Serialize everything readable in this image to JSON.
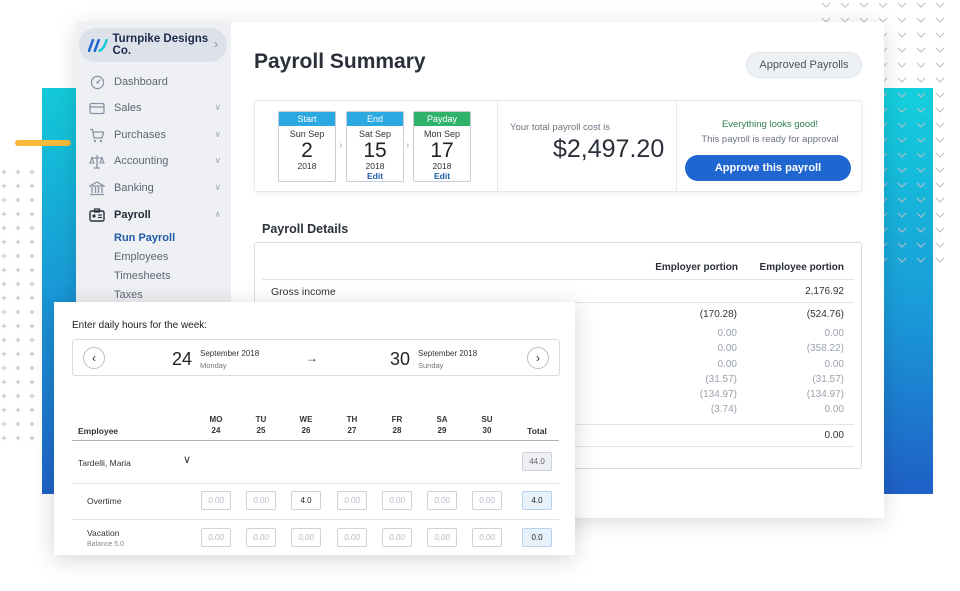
{
  "company": {
    "name": "Turnpike Designs Co."
  },
  "sidebar": {
    "items": [
      {
        "label": "Dashboard",
        "icon": "dashboard-icon",
        "expandable": false
      },
      {
        "label": "Sales",
        "icon": "sales-icon",
        "expandable": true
      },
      {
        "label": "Purchases",
        "icon": "cart-icon",
        "expandable": true
      },
      {
        "label": "Accounting",
        "icon": "scales-icon",
        "expandable": true
      },
      {
        "label": "Banking",
        "icon": "bank-icon",
        "expandable": true
      },
      {
        "label": "Payroll",
        "icon": "payroll-icon",
        "expandable": true,
        "active": true
      }
    ],
    "payroll_sub": [
      "Run Payroll",
      "Employees",
      "Timesheets",
      "Taxes"
    ]
  },
  "page": {
    "title": "Payroll Summary",
    "approved_payrolls_label": "Approved Payrolls"
  },
  "summary": {
    "dates": [
      {
        "head": "Start",
        "dow": "Sun Sep",
        "day": "2",
        "year": "2018",
        "edit": "",
        "color": "#2aa9e0"
      },
      {
        "head": "End",
        "dow": "Sat Sep",
        "day": "15",
        "year": "2018",
        "edit": "Edit",
        "color": "#2aa9e0"
      },
      {
        "head": "Payday",
        "dow": "Mon Sep",
        "day": "17",
        "year": "2018",
        "edit": "Edit",
        "color": "#2fb36b"
      }
    ],
    "total_label": "Your total payroll cost is",
    "total_amount": "$2,497.20",
    "status_ok": "Everything looks good!",
    "status_ready": "This payroll is ready for approval",
    "approve_label": "Approve this payroll"
  },
  "details": {
    "title": "Payroll Details",
    "col_employer": "Employer portion",
    "col_employee": "Employee portion",
    "gross_label": "Gross income",
    "gross_employee": "2,176.92",
    "rows": [
      {
        "employer": "(170.28)",
        "employee": "(524.76)",
        "style": "dark"
      },
      {
        "employer": "0.00",
        "employee": "0.00",
        "style": "muted"
      },
      {
        "employer": "0.00",
        "employee": "(358.22)",
        "style": "muted"
      },
      {
        "employer": "0.00",
        "employee": "0.00",
        "style": "muted"
      },
      {
        "employer": "(31.57)",
        "employee": "(31.57)",
        "style": "muted"
      },
      {
        "employer": "(134.97)",
        "employee": "(134.97)",
        "style": "muted"
      },
      {
        "employer": "(3.74)",
        "employee": "0.00",
        "style": "muted"
      }
    ],
    "bottom_employee": "0.00"
  },
  "hours": {
    "title": "Enter daily hours for the week:",
    "week_start": {
      "day": "24",
      "month": "September 2018",
      "dow": "Monday"
    },
    "week_end": {
      "day": "30",
      "month": "September 2018",
      "dow": "Sunday"
    },
    "days": [
      {
        "dow": "MO",
        "date": "24"
      },
      {
        "dow": "TU",
        "date": "25"
      },
      {
        "dow": "WE",
        "date": "26"
      },
      {
        "dow": "TH",
        "date": "27"
      },
      {
        "dow": "FR",
        "date": "28"
      },
      {
        "dow": "SA",
        "date": "29"
      },
      {
        "dow": "SU",
        "date": "30"
      }
    ],
    "employee_header": "Employee",
    "total_header": "Total",
    "employee_name": "Tardelli, Maria",
    "employee_total": "44.0",
    "rows": [
      {
        "label": "Overtime",
        "sub": "",
        "values": [
          "",
          "",
          "4.0",
          "",
          "",
          "",
          ""
        ],
        "placeholder": "0.00",
        "total": "4.0"
      },
      {
        "label": "Vacation",
        "sub": "Balance 5.0",
        "values": [
          "",
          "",
          "",
          "",
          "",
          "",
          ""
        ],
        "placeholder": "0.00",
        "total": "0.0"
      }
    ]
  },
  "colors": {
    "primary_button": "#1f66d1",
    "link_blue": "#1f5ba8",
    "ok_green": "#2e7d4f",
    "accent_cyan": "#13c9d8",
    "accent_yellow": "#f6b93b"
  }
}
